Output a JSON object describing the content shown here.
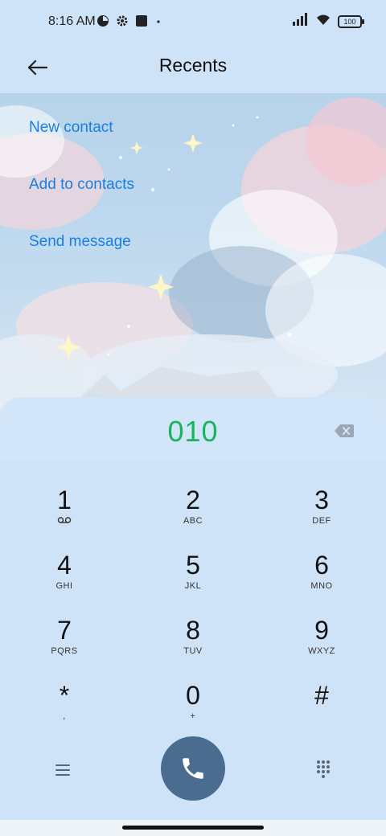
{
  "status_bar": {
    "time": "8:16 AM",
    "battery": "100",
    "icons": [
      "timer-icon",
      "settings-icon",
      "app-square-icon",
      "dot-icon",
      "signal-icon",
      "wifi-icon",
      "battery-icon"
    ]
  },
  "header": {
    "title": "Recents",
    "back_icon": "back-arrow-icon"
  },
  "actions": [
    {
      "label": "New contact"
    },
    {
      "label": "Add to contacts"
    },
    {
      "label": "Send message"
    }
  ],
  "dialer": {
    "number": "010",
    "number_color": "#19b45b",
    "backspace_icon": "backspace-icon"
  },
  "keypad": [
    {
      "digit": "1",
      "letters": "voicemail-icon"
    },
    {
      "digit": "2",
      "letters": "ABC"
    },
    {
      "digit": "3",
      "letters": "DEF"
    },
    {
      "digit": "4",
      "letters": "GHI"
    },
    {
      "digit": "5",
      "letters": "JKL"
    },
    {
      "digit": "6",
      "letters": "MNO"
    },
    {
      "digit": "7",
      "letters": "PQRS"
    },
    {
      "digit": "8",
      "letters": "TUV"
    },
    {
      "digit": "9",
      "letters": "WXYZ"
    },
    {
      "digit": "*",
      "letters": ","
    },
    {
      "digit": "0",
      "letters": "+"
    },
    {
      "digit": "#",
      "letters": ""
    }
  ],
  "bottom_bar": {
    "menu_icon": "menu-icon",
    "call_icon": "phone-icon",
    "call_color": "#4a6d8f",
    "keypad_icon": "dialpad-icon"
  },
  "colors": {
    "background": "#cfe3f8",
    "link": "#1a7fe0"
  }
}
